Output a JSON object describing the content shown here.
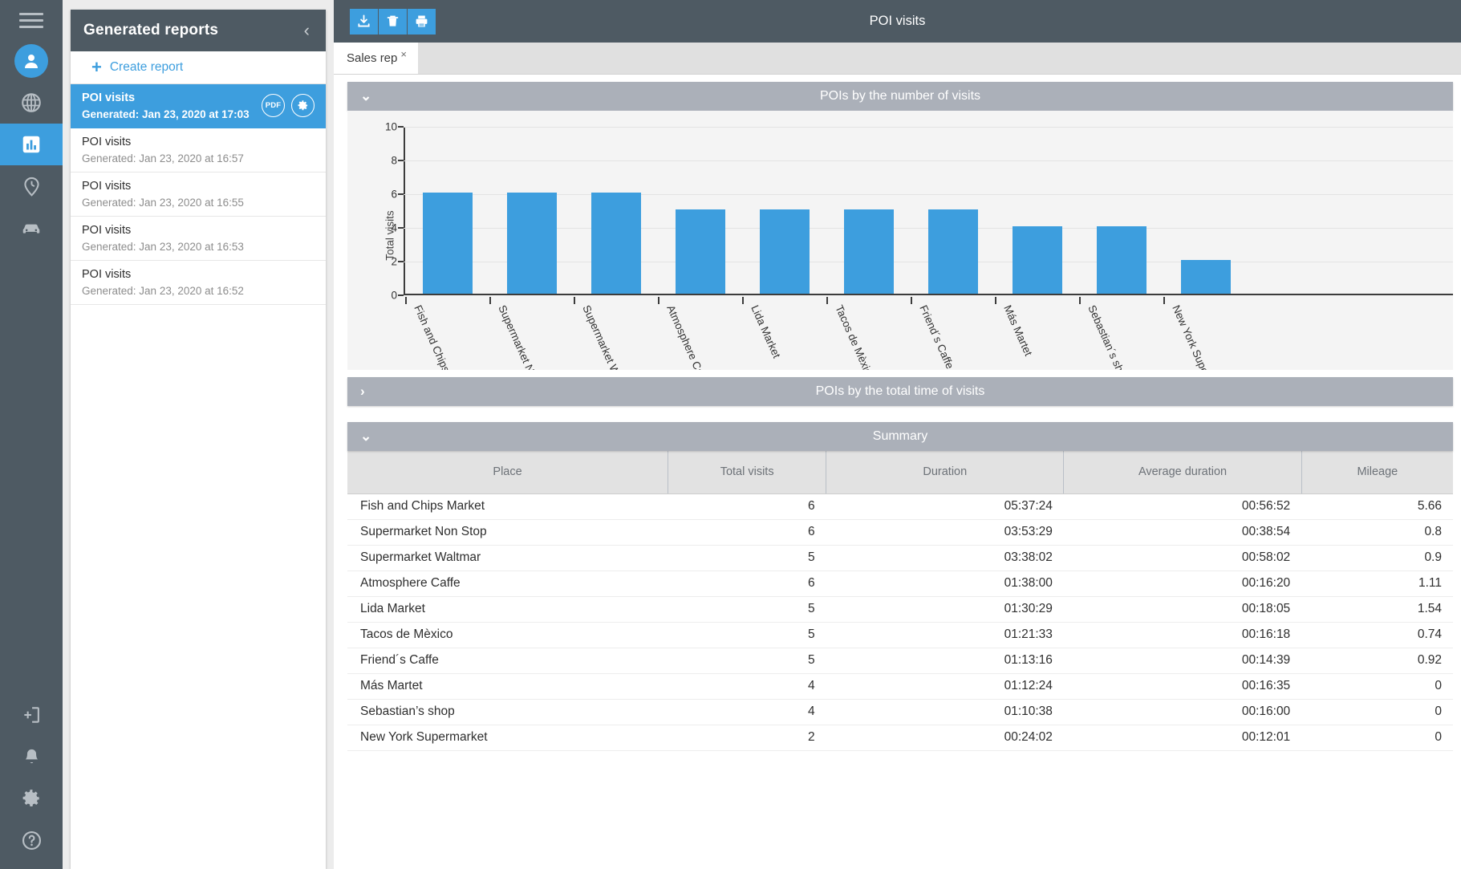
{
  "rail": {
    "items": [
      {
        "name": "menu-icon",
        "label": "Menu"
      },
      {
        "name": "user-icon",
        "label": "Users"
      },
      {
        "name": "globe-icon",
        "label": "Map"
      },
      {
        "name": "chart-icon",
        "label": "Reports"
      },
      {
        "name": "location-clock-icon",
        "label": "History"
      },
      {
        "name": "car-icon",
        "label": "Vehicles"
      }
    ],
    "bottom_items": [
      {
        "name": "logout-icon",
        "label": "Logout"
      },
      {
        "name": "bell-icon",
        "label": "Notifications"
      },
      {
        "name": "gear-icon",
        "label": "Settings"
      },
      {
        "name": "help-icon",
        "label": "Help"
      }
    ]
  },
  "panel": {
    "title": "Generated reports",
    "collapse_label": "‹",
    "create_label": "Create report",
    "create_plus": "+",
    "reports": [
      {
        "title": "POI visits",
        "generated": "Generated: Jan 23, 2020 at 17:03",
        "selected": true,
        "pdf_label": "PDF"
      },
      {
        "title": "POI visits",
        "generated": "Generated: Jan 23, 2020 at 16:57",
        "selected": false
      },
      {
        "title": "POI visits",
        "generated": "Generated: Jan 23, 2020 at 16:55",
        "selected": false
      },
      {
        "title": "POI visits",
        "generated": "Generated: Jan 23, 2020 at 16:53",
        "selected": false
      },
      {
        "title": "POI visits",
        "generated": "Generated: Jan 23, 2020 at 16:52",
        "selected": false
      }
    ]
  },
  "topbar": {
    "title": "POI visits",
    "tools": [
      {
        "name": "download-icon",
        "label": "Download"
      },
      {
        "name": "trash-icon",
        "label": "Delete"
      },
      {
        "name": "print-icon",
        "label": "Print"
      }
    ]
  },
  "tabs": [
    {
      "label": "Sales rep",
      "close": "×",
      "active": true
    }
  ],
  "sections": [
    {
      "title": "POIs by the number of visits",
      "expanded": true,
      "chevron": "⌄"
    },
    {
      "title": "POIs by the total time of visits",
      "expanded": false,
      "chevron": "›"
    },
    {
      "title": "Summary",
      "expanded": true,
      "chevron": "⌄"
    }
  ],
  "chart_data": {
    "type": "bar",
    "title": "POIs by the number of visits",
    "xlabel": "",
    "ylabel": "Total visits",
    "ylim": [
      0,
      10
    ],
    "yticks": [
      0,
      2,
      4,
      6,
      8,
      10
    ],
    "grid": true,
    "legend": "none",
    "categories": [
      "Fish and Chips Mar",
      "Supermarket Non S",
      "Supermarket Waltm",
      "Atmosphere Caffe",
      "Lida Market",
      "Tacos de Mèxico",
      "Friend´s Caffe",
      "Más Martet",
      "Sebastian´s shop",
      "New York Superma"
    ],
    "values": [
      6,
      6,
      6,
      5,
      5,
      5,
      5,
      4,
      4,
      2
    ]
  },
  "table": {
    "columns": [
      "Place",
      "Total visits",
      "Duration",
      "Average duration",
      "Mileage"
    ],
    "rows": [
      {
        "place": "Fish and Chips Market",
        "visits": "6",
        "duration": "05:37:24",
        "average": "00:56:52",
        "mileage": "5.66"
      },
      {
        "place": "Supermarket Non Stop",
        "visits": "6",
        "duration": "03:53:29",
        "average": "00:38:54",
        "mileage": "0.8"
      },
      {
        "place": "Supermarket Waltmar",
        "visits": "5",
        "duration": "03:38:02",
        "average": "00:58:02",
        "mileage": "0.9"
      },
      {
        "place": "Atmosphere Caffe",
        "visits": "6",
        "duration": "01:38:00",
        "average": "00:16:20",
        "mileage": "1.11"
      },
      {
        "place": "Lida Market",
        "visits": "5",
        "duration": "01:30:29",
        "average": "00:18:05",
        "mileage": "1.54"
      },
      {
        "place": "Tacos de Mèxico",
        "visits": "5",
        "duration": "01:21:33",
        "average": "00:16:18",
        "mileage": "0.74"
      },
      {
        "place": "Friend´s Caffe",
        "visits": "5",
        "duration": "01:13:16",
        "average": "00:14:39",
        "mileage": "0.92"
      },
      {
        "place": "Más Martet",
        "visits": "4",
        "duration": "01:12:24",
        "average": "00:16:35",
        "mileage": "0"
      },
      {
        "place": "Sebastian’s shop",
        "visits": "4",
        "duration": "01:10:38",
        "average": "00:16:00",
        "mileage": "0"
      },
      {
        "place": "New York Supermarket",
        "visits": "2",
        "duration": "00:24:02",
        "average": "00:12:01",
        "mileage": "0"
      }
    ]
  },
  "colors": {
    "accent": "#3d9ede",
    "rail": "#4e5a63",
    "section_bar": "#abb0b9",
    "table_header": "#e2e2e2"
  }
}
